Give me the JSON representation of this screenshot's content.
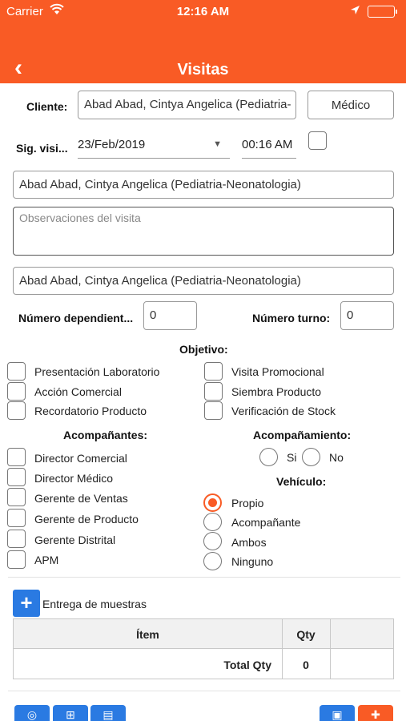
{
  "status_bar": {
    "carrier": "Carrier",
    "time": "12:16 AM"
  },
  "header": {
    "back_icon": "‹",
    "title": "Visitas"
  },
  "form": {
    "cliente_label": "Cliente:",
    "cliente_value": "Abad Abad, Cintya Angelica (Pediatria-",
    "medico_button": "Médico",
    "sig_visita_label": "Sig. visi...",
    "date_value": "23/Feb/2019",
    "time_value": "00:16 AM",
    "contact_value": "Abad Abad, Cintya Angelica (Pediatria-Neonatologia)",
    "observaciones_placeholder": "Observaciones del visita",
    "contact2_value": "Abad Abad, Cintya Angelica (Pediatria-Neonatologia)",
    "num_dependientes_label": "Número dependient...",
    "num_dependientes_value": "0",
    "num_turno_label": "Número turno:",
    "num_turno_value": "0"
  },
  "objetivo": {
    "title": "Objetivo:",
    "left": [
      "Presentación Laboratorio",
      "Acción Comercial",
      "Recordatorio Producto"
    ],
    "right": [
      "Visita Promocional",
      "Siembra Producto",
      "Verificación de Stock"
    ]
  },
  "acompanantes": {
    "title": "Acompañantes:",
    "items": [
      "Director Comercial",
      "Director Médico",
      "Gerente de Ventas",
      "Gerente de Producto",
      "Gerente Distrital",
      "APM"
    ]
  },
  "acompanamiento": {
    "title": "Acompañamiento:",
    "si": "Si",
    "no": "No"
  },
  "vehiculo": {
    "title": "Vehículo:",
    "options": [
      "Propio",
      "Acompañante",
      "Ambos",
      "Ninguno"
    ],
    "selected": "Propio"
  },
  "muestras": {
    "add_icon": "+",
    "label": "Entrega de muestras",
    "col_item": "Ítem",
    "col_qty": "Qty",
    "total_label": "Total Qty",
    "total_value": "0"
  },
  "colors": {
    "accent": "#f95b25",
    "action_blue": "#2a7ae2"
  }
}
